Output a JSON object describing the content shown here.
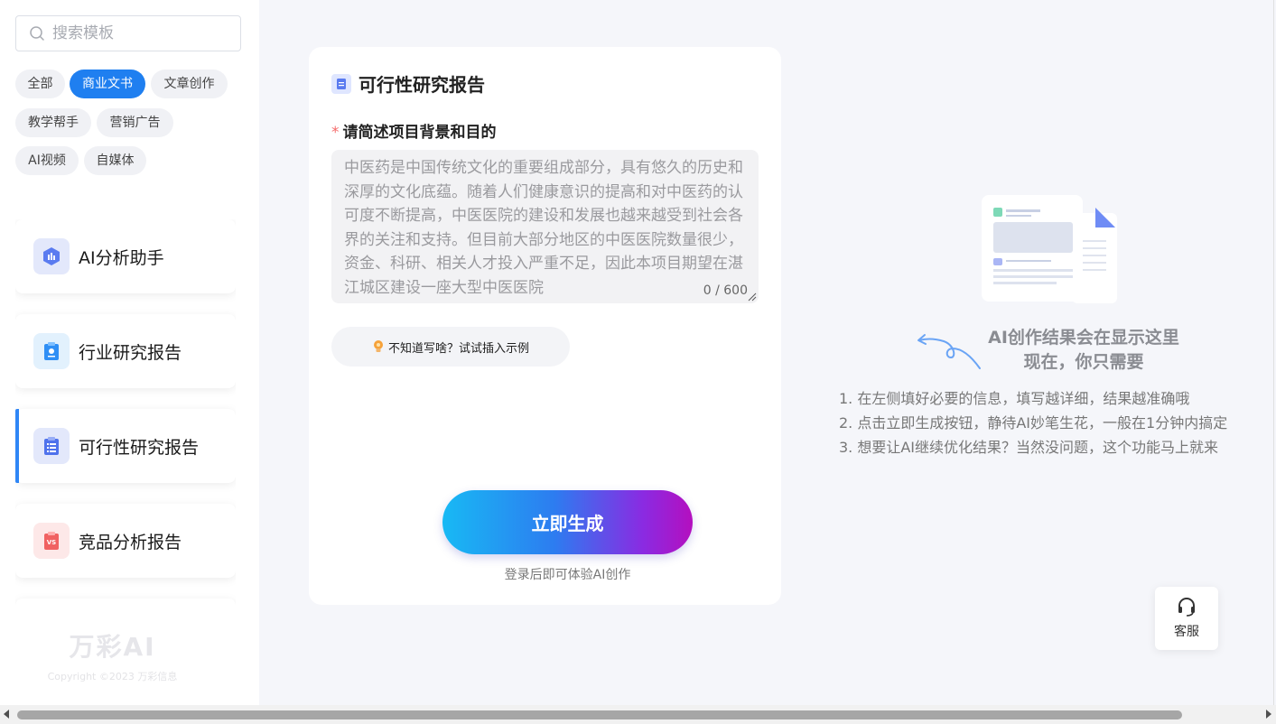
{
  "search": {
    "placeholder": "搜索模板"
  },
  "categories": [
    "全部",
    "商业文书",
    "文章创作",
    "教学帮手",
    "营销广告",
    "AI视频",
    "自媒体"
  ],
  "active_category": "商业文书",
  "templates": [
    {
      "label": "AI分析助手",
      "icon": "hexagon-chart-icon"
    },
    {
      "label": "行业研究报告",
      "icon": "clipboard-chart-icon"
    },
    {
      "label": "可行性研究报告",
      "icon": "clipboard-list-icon",
      "active": true
    },
    {
      "label": "竞品分析报告",
      "icon": "clipboard-vs-icon"
    }
  ],
  "brand": {
    "logo": "万彩AI",
    "copyright": "Copyright ©2023 万彩信息"
  },
  "form": {
    "title": "可行性研究报告",
    "required_mark": "*",
    "field_label": "请简述项目背景和目的",
    "field_placeholder": "中医药是中国传统文化的重要组成部分，具有悠久的历史和深厚的文化底蕴。随着人们健康意识的提高和对中医药的认可度不断提高，中医医院的建设和发展也越来越受到社会各界的关注和支持。但目前大部分地区的中医医院数量很少，资金、科研、相关人才投入严重不足，因此本项目期望在湛江城区建设一座大型中医医院",
    "counter": "0 / 600",
    "example_button": "不知道写啥？试试插入示例",
    "generate_button": "立即生成",
    "login_hint": "登录后即可体验AI创作"
  },
  "result": {
    "title_line1": "AI创作结果会在显示这里",
    "title_line2": "现在，你只需要",
    "tips": [
      "1. 在左侧填好必要的信息，填写越详细，结果越准确哦",
      "2. 点击立即生成按钮，静待AI妙笔生花，一般在1分钟内搞定",
      "3. 想要让AI继续优化结果？当然没问题，这个功能马上就来"
    ]
  },
  "service": {
    "label": "客服"
  },
  "colors": {
    "accent": "#1f7ff0",
    "panel_bg": "#f5f6fa"
  }
}
